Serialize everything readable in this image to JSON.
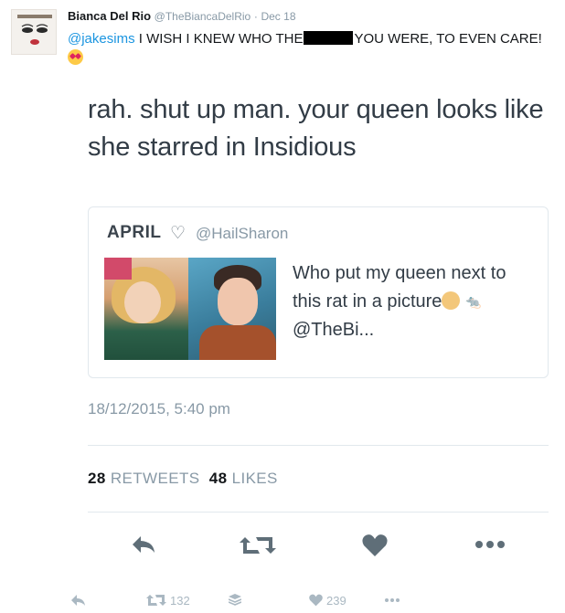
{
  "tweet": {
    "author_name": "Bianca Del Rio",
    "author_handle": "@TheBiancaDelRio",
    "separator": "·",
    "date": "Dec 18",
    "reply_mention": "@jakesims",
    "text_before_redaction": "I WISH I KNEW WHO THE",
    "text_after_redaction": "YOU WERE, TO EVEN CARE!",
    "avatar_icon": "face-avatar-icon",
    "emoji": "heart-eyes-emoji"
  },
  "screenshot": {
    "text": "rah. shut up man. your queen looks like she starred in Insidious",
    "quoted": {
      "name": "APRIL",
      "heart": "♡",
      "handle": "@HailSharon",
      "text_main": "Who put my queen next to this rat in a picture",
      "text_mention": "@TheBi..."
    },
    "timestamp": "18/12/2015, 5:40 pm",
    "retweets_count": "28",
    "retweets_label": "RETWEETS",
    "likes_count": "48",
    "likes_label": "LIKES",
    "actions": [
      "reply-icon",
      "retweet-icon",
      "like-icon",
      "more-icon"
    ]
  },
  "footer_actions": {
    "retweet_count": "132",
    "like_count": "239"
  },
  "colors": {
    "mention": "#1b95e0",
    "muted": "#8899a6",
    "border": "#e1e8ed"
  }
}
